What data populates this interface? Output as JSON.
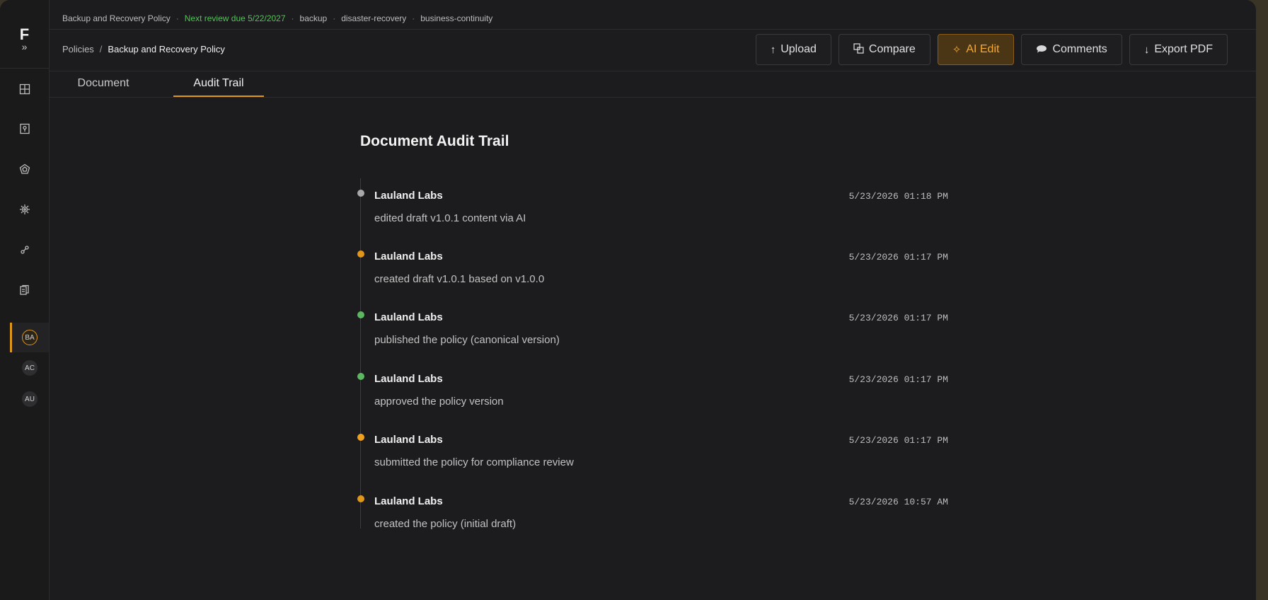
{
  "header": {
    "doc_title": "Backup and Recovery Policy",
    "review_due": "Next review due 5/22/2027",
    "tags": [
      "backup",
      "disaster-recovery",
      "business-continuity"
    ]
  },
  "breadcrumb": {
    "root": "Policies",
    "separator": "/",
    "current": "Backup and Recovery Policy"
  },
  "toolbar": {
    "upload": {
      "label": "Upload",
      "icon": "upload-arrow-icon"
    },
    "compare": {
      "label": "Compare",
      "icon": "compare-icon"
    },
    "ai_edit": {
      "label": "AI Edit",
      "icon": "sparkle-icon"
    },
    "comments": {
      "label": "Comments",
      "icon": "comment-bubble-icon"
    },
    "export_pdf": {
      "label": "Export PDF",
      "icon": "download-arrow-icon"
    }
  },
  "tabs": [
    {
      "label": "Document",
      "active": false
    },
    {
      "label": "Audit Trail",
      "active": true
    }
  ],
  "sidebar": {
    "logo": "F",
    "expand_glyph": "»",
    "icons": [
      "dashboard-grid-icon",
      "policy-lock-icon",
      "frameworks-icon",
      "settings-gear-icon",
      "integrations-link-icon",
      "documents-icon"
    ],
    "avatars": [
      {
        "initials": "BA",
        "active": true
      },
      {
        "initials": "AC",
        "active": false
      },
      {
        "initials": "AU",
        "active": false
      }
    ]
  },
  "audit": {
    "title": "Document Audit Trail",
    "entries": [
      {
        "actor": "Lauland Labs",
        "timestamp": "5/23/2026 01:18 PM",
        "action": "edited draft v1.0.1 content via AI",
        "dot_color": "#a8a8a8"
      },
      {
        "actor": "Lauland Labs",
        "timestamp": "5/23/2026 01:17 PM",
        "action": "created draft v1.0.1 based on v1.0.0",
        "dot_color": "#e0961a"
      },
      {
        "actor": "Lauland Labs",
        "timestamp": "5/23/2026 01:17 PM",
        "action": "published the policy (canonical version)",
        "dot_color": "#5cb860"
      },
      {
        "actor": "Lauland Labs",
        "timestamp": "5/23/2026 01:17 PM",
        "action": "approved the policy version",
        "dot_color": "#5cb860"
      },
      {
        "actor": "Lauland Labs",
        "timestamp": "5/23/2026 01:17 PM",
        "action": "submitted the policy for compliance review",
        "dot_color": "#f0a020"
      },
      {
        "actor": "Lauland Labs",
        "timestamp": "5/23/2026 10:57 AM",
        "action": "created the policy (initial draft)",
        "dot_color": "#e0961a"
      }
    ]
  },
  "colors": {
    "accent": "#e0961a",
    "review_green": "#56c05b",
    "background": "#1c1c1e"
  }
}
